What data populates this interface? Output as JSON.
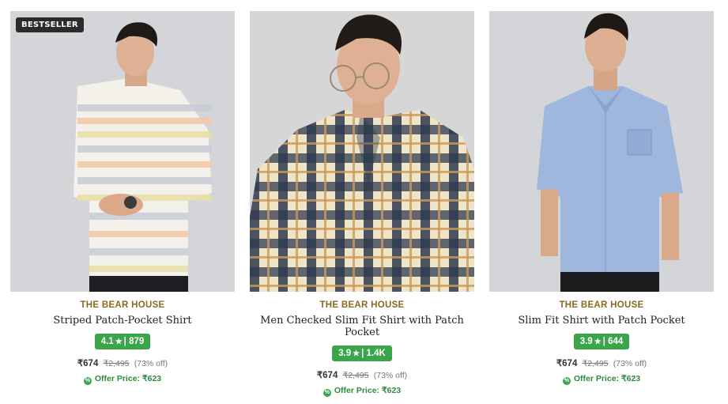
{
  "products": [
    {
      "badge": "BESTSELLER",
      "brand": "THE BEAR HOUSE",
      "title": "Striped Patch-Pocket Shirt",
      "rating": "4.1",
      "rating_count": "879",
      "price": "₹674",
      "mrp": "₹2,495",
      "discount": "(73% off)",
      "offer": "Offer Price: ₹623"
    },
    {
      "brand": "THE BEAR HOUSE",
      "title": "Men Checked Slim Fit Shirt with Patch Pocket",
      "rating": "3.9",
      "rating_count": "1.4K",
      "price": "₹674",
      "mrp": "₹2,495",
      "discount": "(73% off)",
      "offer": "Offer Price: ₹623"
    },
    {
      "brand": "THE BEAR HOUSE",
      "title": "Slim Fit Shirt with Patch Pocket",
      "rating": "3.9",
      "rating_count": "644",
      "price": "₹674",
      "mrp": "₹2,495",
      "discount": "(73% off)",
      "offer": "Offer Price: ₹623"
    }
  ],
  "rating_separator": "|",
  "colors": {
    "brand": "#8a6a1f",
    "rating_bg": "#3ba54b",
    "offer": "#2e8b3a",
    "badge_bg": "#2b2b2b"
  },
  "icons": {
    "rating": "star-icon",
    "offer": "offer-tag-icon"
  }
}
